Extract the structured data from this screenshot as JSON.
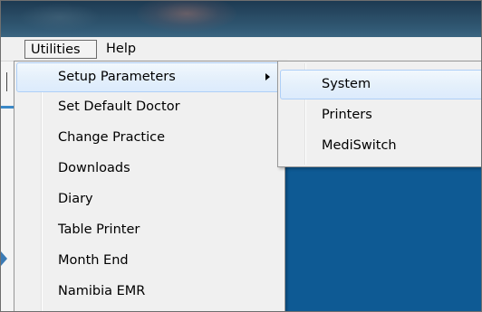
{
  "menubar": {
    "items": [
      {
        "label": "Utilities"
      },
      {
        "label": "Help"
      }
    ]
  },
  "utilities_menu": {
    "items": [
      {
        "label": "Setup Parameters",
        "has_submenu": true,
        "highlighted": true
      },
      {
        "label": "Set Default Doctor"
      },
      {
        "label": "Change Practice"
      },
      {
        "label": "Downloads"
      },
      {
        "label": "Diary"
      },
      {
        "label": "Table Printer"
      },
      {
        "label": "Month End"
      },
      {
        "label": "Namibia EMR"
      }
    ]
  },
  "setup_submenu": {
    "items": [
      {
        "label": "System",
        "highlighted": true
      },
      {
        "label": "Printers"
      },
      {
        "label": "MediSwitch"
      }
    ]
  },
  "colors": {
    "highlight_border": "#aecff7",
    "highlight_fill": "#e5f0fb",
    "menu_background": "#f0f0f0",
    "app_background": "#0e5a94"
  }
}
